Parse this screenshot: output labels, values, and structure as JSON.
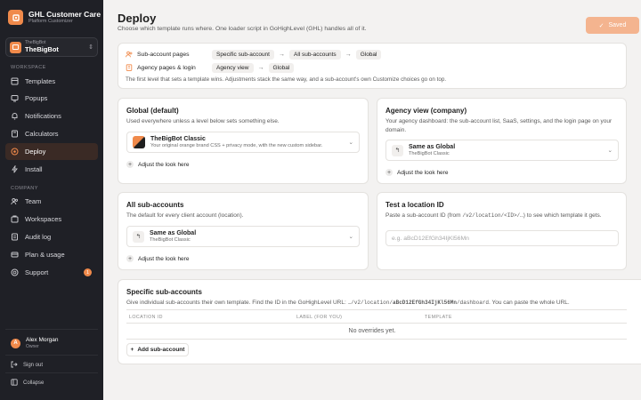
{
  "brand": {
    "title": "GHL Customer Care",
    "subtitle": "Platform Customizer"
  },
  "location_switch": {
    "label": "TheBigBot",
    "name": "TheBigBot"
  },
  "sidebar": {
    "workspace_label": "WORKSPACE",
    "company_label": "COMPANY",
    "workspace_items": [
      {
        "label": "Templates",
        "icon": "templates-icon"
      },
      {
        "label": "Popups",
        "icon": "popups-icon"
      },
      {
        "label": "Notifications",
        "icon": "bell-icon"
      },
      {
        "label": "Calculators",
        "icon": "calculator-icon"
      },
      {
        "label": "Deploy",
        "icon": "target-icon"
      },
      {
        "label": "Install",
        "icon": "bolt-icon"
      }
    ],
    "company_items": [
      {
        "label": "Team",
        "icon": "team-icon"
      },
      {
        "label": "Workspaces",
        "icon": "workspaces-icon"
      },
      {
        "label": "Audit log",
        "icon": "audit-icon"
      },
      {
        "label": "Plan & usage",
        "icon": "plan-icon"
      },
      {
        "label": "Support",
        "icon": "support-icon",
        "badge": "1"
      }
    ],
    "user": {
      "initial": "A",
      "name": "Alex Morgan",
      "role": "Owner"
    },
    "sign_out": "Sign out",
    "collapse": "Collapse"
  },
  "header": {
    "title": "Deploy",
    "subtitle": "Choose which template runs where. One loader script in GoHighLevel (GHL) handles all of it.",
    "saved_label": "Saved"
  },
  "flow": {
    "row1": {
      "label": "Sub-account pages",
      "steps": [
        "Specific sub-account",
        "All sub-accounts",
        "Global"
      ]
    },
    "row2": {
      "label": "Agency pages & login",
      "steps": [
        "Agency view",
        "Global"
      ]
    },
    "note": "The first level that sets a template wins. Adjustments stack the same way, and a sub-account's own Customize choices go on top."
  },
  "global_card": {
    "title": "Global (default)",
    "desc": "Used everywhere unless a level below sets something else.",
    "select_title": "TheBigBot Classic",
    "select_sub": "Your original orange brand CSS + privacy mode, with the new custom sidebar.",
    "adjust": "Adjust the look here"
  },
  "agency_card": {
    "title": "Agency view (company)",
    "desc": "Your agency dashboard: the sub-account list, SaaS, settings, and the login page on your domain.",
    "select_title": "Same as Global",
    "select_sub": "TheBigBot Classic",
    "adjust": "Adjust the look here"
  },
  "all_sub_card": {
    "title": "All sub-accounts",
    "desc": "The default for every client account (location).",
    "select_title": "Same as Global",
    "select_sub": "TheBigBot Classic",
    "adjust": "Adjust the look here"
  },
  "test_card": {
    "title": "Test a location ID",
    "desc_pre": "Paste a sub-account ID (from ",
    "desc_code": "/v2/location/<ID>/…",
    "desc_post": ") to see which template it gets.",
    "placeholder": "e.g. aBcD12EfGh34IjKl56Mn"
  },
  "specific_card": {
    "title": "Specific sub-accounts",
    "desc_pre": "Give individual sub-accounts their own template. Find the ID in the GoHighLevel URL: ",
    "desc_code_a": "…/v2/location/",
    "desc_code_b": "aBcD12EfGh34IjKl56Mn",
    "desc_code_c": "/dashboard",
    "desc_post": ". You can paste the whole URL.",
    "columns": [
      "LOCATION ID",
      "LABEL (FOR YOU)",
      "TEMPLATE"
    ],
    "empty": "No overrides yet.",
    "add_label": "Add sub-account"
  }
}
